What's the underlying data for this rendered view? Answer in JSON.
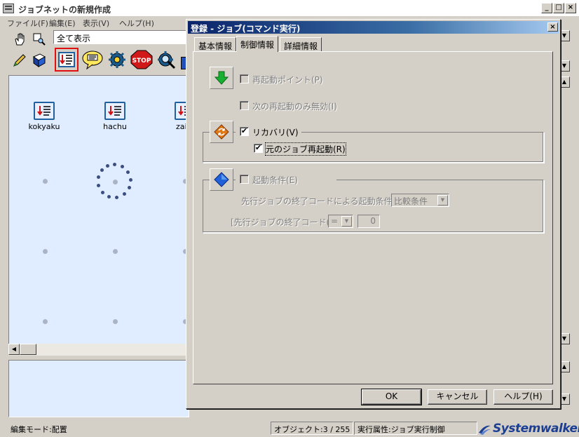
{
  "app": {
    "title": "ジョブネットの新規作成",
    "menu": [
      "ファイル(F)",
      "編集(E)",
      "表示(V)",
      "ヘルプ(H)"
    ],
    "filter_combo": "全て表示",
    "canvas_jobs": [
      {
        "label": "kokyaku"
      },
      {
        "label": "hachu"
      },
      {
        "label": "zai"
      }
    ]
  },
  "status": {
    "mode": "編集モード:配置",
    "objects": "オブジェクト:3 / 255",
    "exec_attr": "実行属性:ジョブ実行制御",
    "logo": "Systemwalker"
  },
  "dialog": {
    "title": "登録 - ジョブ(コマンド実行)",
    "tabs": [
      {
        "label": "基本情報",
        "active": false
      },
      {
        "label": "制御情報",
        "active": true
      },
      {
        "label": "詳細情報",
        "active": false
      }
    ],
    "restart_point": {
      "label": "再起動ポイント(P)",
      "checked": false,
      "enabled": false
    },
    "next_restart_disable": {
      "label": "次の再起動のみ無効(I)",
      "checked": false,
      "enabled": false
    },
    "recovery": {
      "label": "リカバリ(V)",
      "checked": true,
      "enabled": true
    },
    "restart_original": {
      "label": "元のジョブ再起動(R)",
      "checked": true,
      "enabled": true
    },
    "start_condition": {
      "label": "起動条件(E)",
      "checked": false,
      "enabled": false
    },
    "condition_by_code": {
      "label": "先行ジョブの終了コードによる起動条件(C):",
      "value": "比較条件"
    },
    "preceding_code": {
      "label": "[先行ジョブの終了コード(O)]",
      "operator": "=",
      "value": "0"
    },
    "buttons": {
      "ok": "OK",
      "cancel": "キャンセル",
      "help": "ヘルプ(H)"
    }
  },
  "colors": {
    "dialog_title_start": "#0a246a",
    "dialog_title_end": "#a6caf0",
    "canvas_bg": "#e0ecff",
    "logo": "#1c3f94"
  }
}
